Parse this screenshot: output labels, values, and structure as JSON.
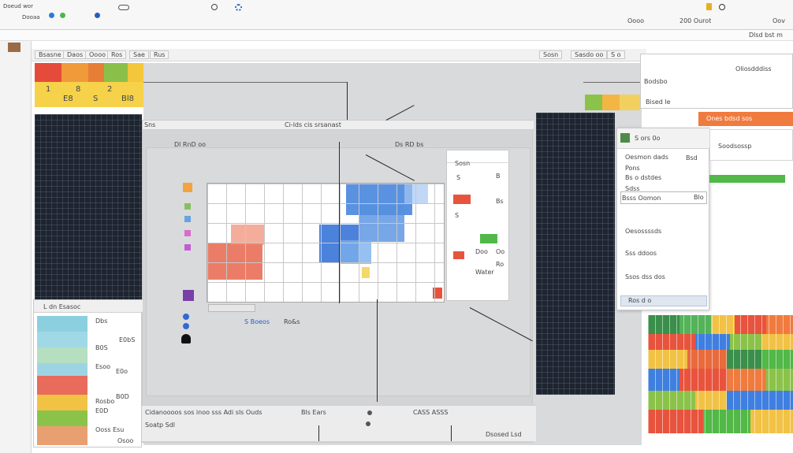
{
  "window": {
    "menu_left": "Dooaa",
    "menu_mid": "Doeud wor",
    "top_right_a": "Oooo",
    "top_right_b": "200 Ourot",
    "top_right_c": "Oov",
    "sub_right": "Dlsd bst m"
  },
  "toolbar": {
    "tabs": [
      "Bsasne",
      "Daos",
      "Oooo",
      "Ros",
      "Sae",
      "Rus"
    ],
    "right_tabs": [
      "Sosn",
      "Sasdo oo",
      "S o"
    ]
  },
  "left_sheet": {
    "row1": [
      "1",
      "8",
      "2"
    ],
    "row2": [
      "E8",
      "S",
      "Bl8"
    ]
  },
  "main_window": {
    "title": "Sns",
    "caption": "Ci-lds cis srsanast",
    "sub_caption": "Dl RnD oo",
    "sub_caption_b": "Ds RD bs",
    "legend_label": "S Boeos",
    "legend_value": "Ro&s",
    "footer_left": "Cidanoooos sos inoo sss Adi sls Ouds",
    "footer_mid": "Bls Ears",
    "footer_mid2": "CASS ASSS",
    "footer_status": "Dsosed Lsd",
    "footer_b": "Soatp Sdl"
  },
  "dropdown": {
    "items": [
      "Sosn",
      "S",
      "B",
      "S",
      "Bs",
      "Doo",
      "Oo",
      "Ro"
    ],
    "footer": "Water"
  },
  "right_panel": {
    "title": "Oliosdddiss",
    "items": [
      "Bodsbo",
      "Bised le",
      "Soodsossp"
    ],
    "banner": "Ones bdsd sos"
  },
  "context_menu": {
    "header": "S ors 0o",
    "items": [
      "Oesmon dads",
      "Pons",
      "Bs o dstdes",
      "Sdss",
      "Bsss Oomon",
      "Oesossssds",
      "Sss ddoos",
      "Ssos dss dos",
      "Ros d o"
    ],
    "right_badge": "Bsd",
    "right_badge2": "Blo"
  },
  "left_bottom": {
    "title": "L dn Esasoc",
    "labels": [
      "Dbs",
      "E0bS",
      "B0S",
      "Esoo",
      "E0o",
      "Rosbo",
      "B0D",
      "E0D"
    ],
    "footer_a": "Ooss Esu",
    "footer_b": "Osoo"
  },
  "colors": {
    "accent_blue": "#3f7fe0",
    "accent_red": "#e8533d",
    "accent_green": "#52b848",
    "dark_bg": "#1e2430"
  }
}
